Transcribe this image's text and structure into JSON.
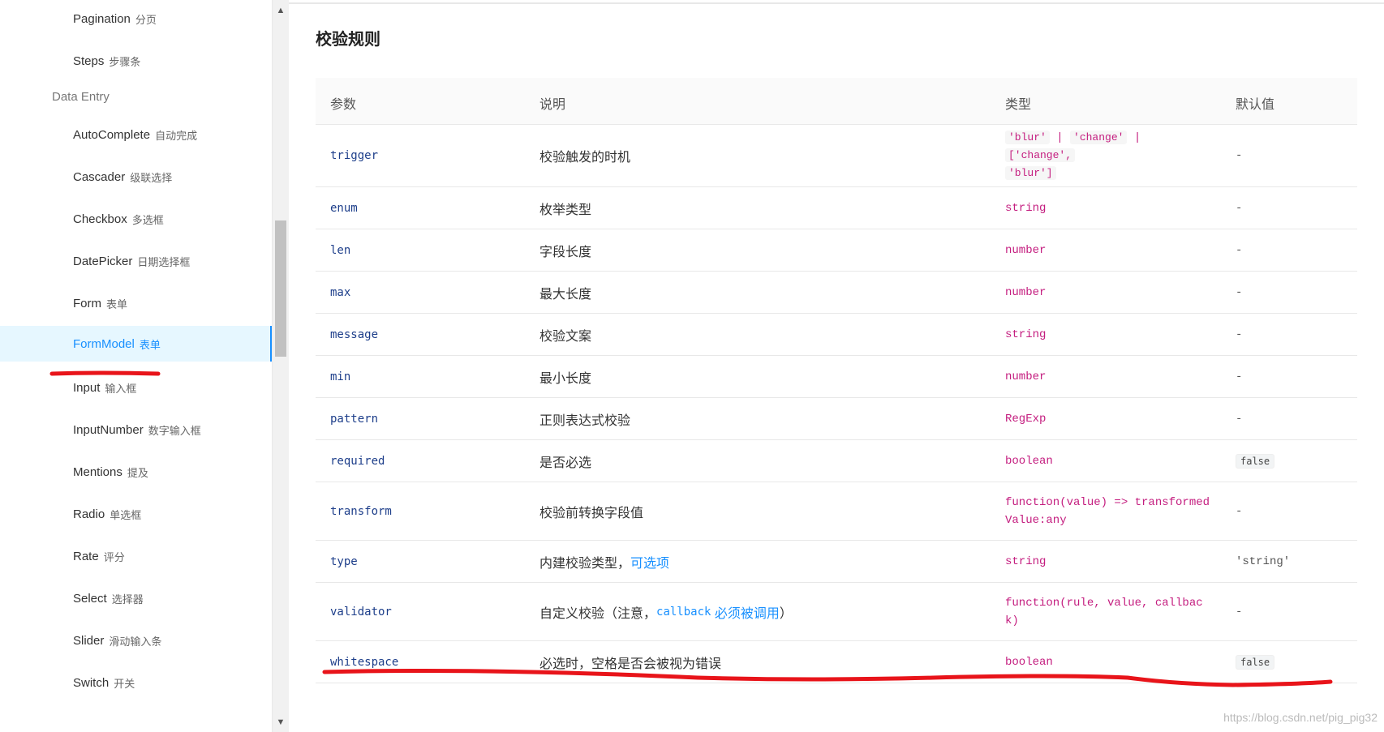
{
  "sidebar": {
    "items_top": [
      {
        "name": "Pagination",
        "sub": "分页"
      },
      {
        "name": "Steps",
        "sub": "步骤条"
      }
    ],
    "group_label": "Data Entry",
    "items": [
      {
        "name": "AutoComplete",
        "sub": "自动完成"
      },
      {
        "name": "Cascader",
        "sub": "级联选择"
      },
      {
        "name": "Checkbox",
        "sub": "多选框"
      },
      {
        "name": "DatePicker",
        "sub": "日期选择框"
      },
      {
        "name": "Form",
        "sub": "表单"
      },
      {
        "name": "FormModel",
        "sub": "表单"
      },
      {
        "name": "Input",
        "sub": "输入框"
      },
      {
        "name": "InputNumber",
        "sub": "数字输入框"
      },
      {
        "name": "Mentions",
        "sub": "提及"
      },
      {
        "name": "Radio",
        "sub": "单选框"
      },
      {
        "name": "Rate",
        "sub": "评分"
      },
      {
        "name": "Select",
        "sub": "选择器"
      },
      {
        "name": "Slider",
        "sub": "滑动输入条"
      },
      {
        "name": "Switch",
        "sub": "开关"
      }
    ],
    "selected_item": "FormModel"
  },
  "scrollbar": {
    "up_icon": "chevron-up-icon",
    "down_icon": "chevron-down-icon"
  },
  "main": {
    "title": "校验规则",
    "headers": [
      "参数",
      "说明",
      "类型",
      "默认值"
    ],
    "rows": [
      {
        "param": "trigger",
        "desc": "校验触发的时机",
        "type_parts": [
          "'blur'",
          "|",
          "'change'",
          "|",
          "['change',",
          "'blur']"
        ],
        "default": "-"
      },
      {
        "param": "enum",
        "desc": "枚举类型",
        "type": "string",
        "default": "-"
      },
      {
        "param": "len",
        "desc": "字段长度",
        "type": "number",
        "default": "-"
      },
      {
        "param": "max",
        "desc": "最大长度",
        "type": "number",
        "default": "-"
      },
      {
        "param": "message",
        "desc": "校验文案",
        "type": "string",
        "default": "-"
      },
      {
        "param": "min",
        "desc": "最小长度",
        "type": "number",
        "default": "-"
      },
      {
        "param": "pattern",
        "desc": "正则表达式校验",
        "type": "RegExp",
        "default": "-"
      },
      {
        "param": "required",
        "desc": "是否必选",
        "type": "boolean",
        "default": "false"
      },
      {
        "param": "transform",
        "desc": "校验前转换字段值",
        "type_line1": "function(value) => transformed",
        "type_line2": "Value:any",
        "default": "-"
      },
      {
        "param": "type",
        "desc": "内建校验类型，",
        "desc_link": "可选项",
        "type": "string",
        "default": "'string'"
      },
      {
        "param": "validator",
        "desc_pre": "自定义校验（注意，",
        "desc_code": "callback",
        "desc_link": "必须被调用",
        "desc_post": "）",
        "type_line1": "function(rule, value, callbac",
        "type_line2": "k)",
        "default": "-"
      },
      {
        "param": "whitespace",
        "desc": "必选时，空格是否会被视为错误",
        "type": "boolean",
        "default": "false"
      }
    ]
  },
  "watermark": "https://blog.csdn.net/pig_pig32",
  "colors": {
    "accent": "#1890ff",
    "annotation": "#e8141a",
    "type_text": "#c41d7f"
  }
}
